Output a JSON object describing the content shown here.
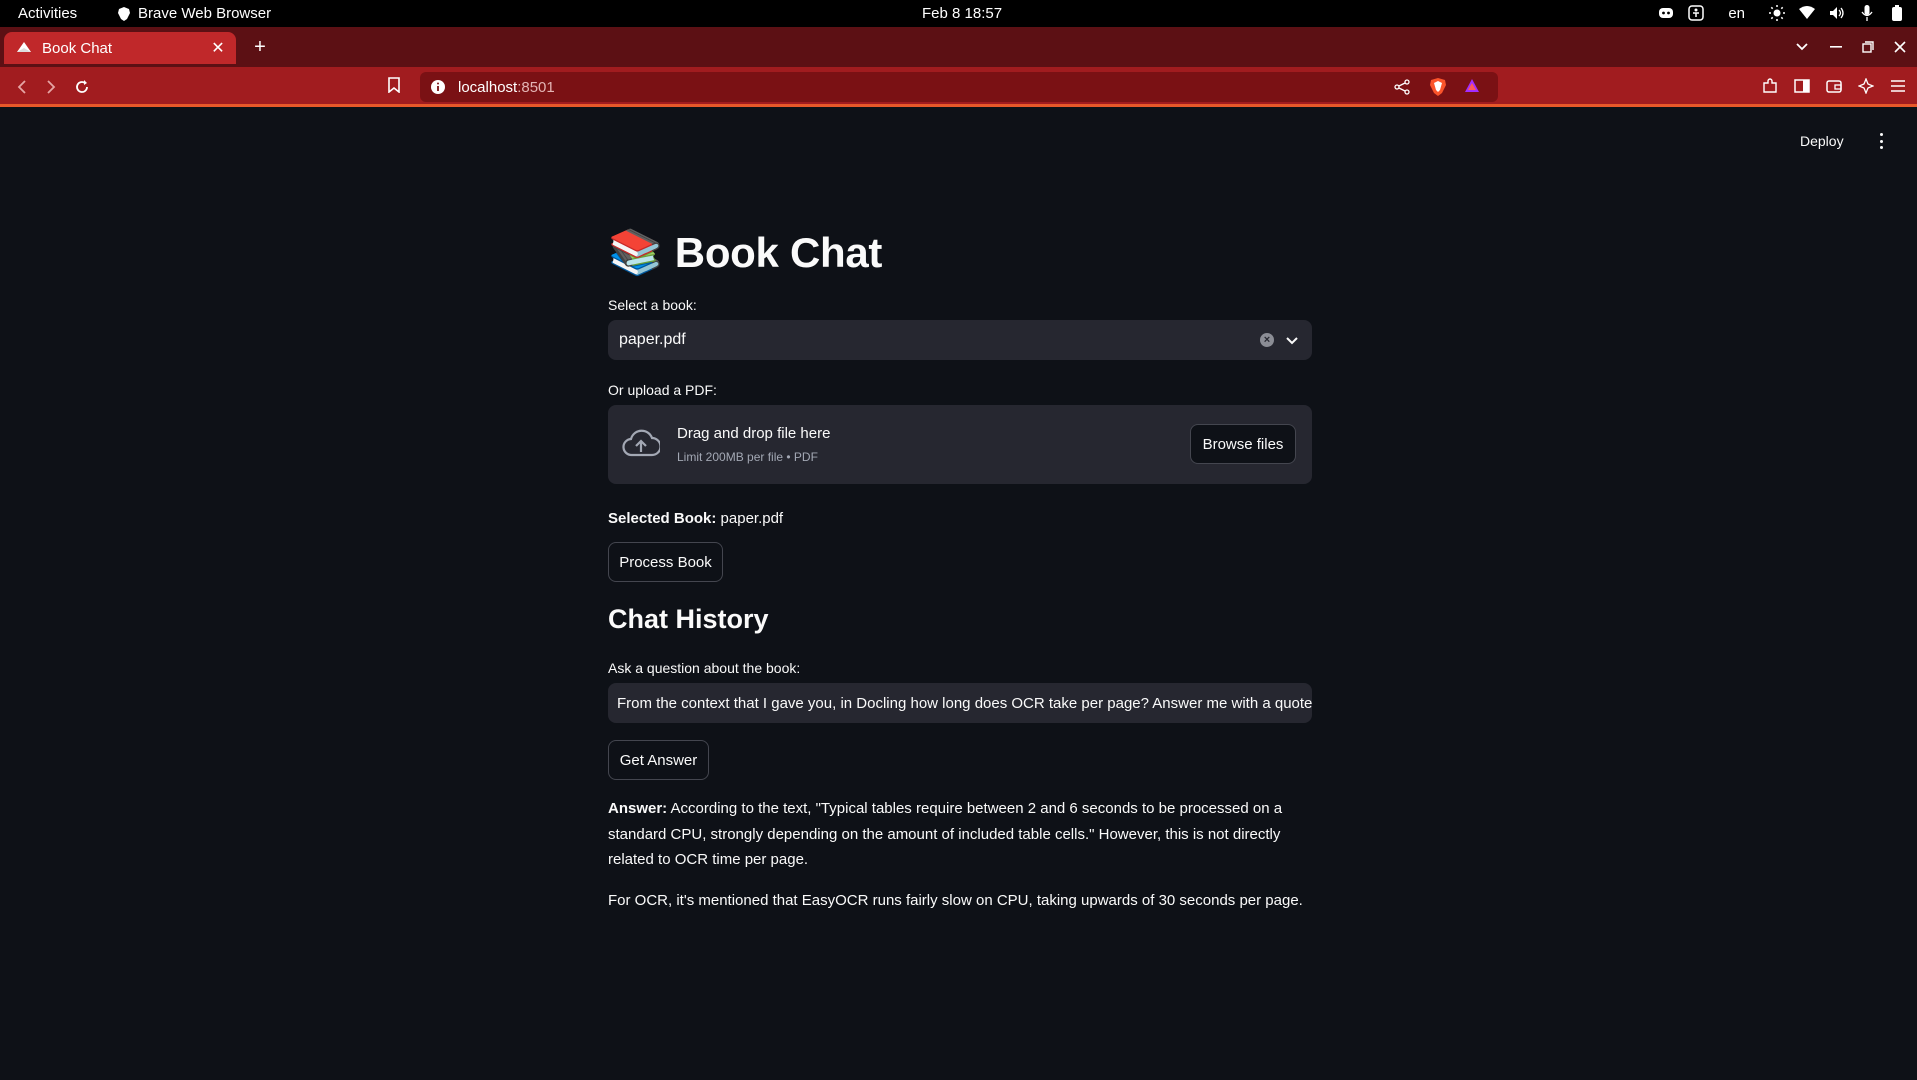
{
  "system": {
    "activities": "Activities",
    "app_name": "Brave Web Browser",
    "clock": "Feb 8  18:57",
    "lang": "en"
  },
  "browser": {
    "tab_title": "Book Chat",
    "url_host": "localhost",
    "url_port": ":8501"
  },
  "header": {
    "deploy_label": "Deploy"
  },
  "page": {
    "title_emoji": "📚",
    "title": "Book Chat",
    "select_label": "Select a book:",
    "select_value": "paper.pdf",
    "upload_label": "Or upload a PDF:",
    "upload_dropzone_text": "Drag and drop file here",
    "upload_limit_text": "Limit 200MB per file • PDF",
    "browse_label": "Browse files",
    "selected_book_label": "Selected Book:",
    "selected_book_value": " paper.pdf",
    "process_label": "Process Book",
    "chat_history_heading": "Chat History",
    "question_label": "Ask a question about the book:",
    "question_value": "From the context that I gave you, in Docling how long does OCR take per page? Answer me with a quote",
    "get_answer_label": "Get Answer",
    "answer_label": "Answer:",
    "answer_text": " According to the text, \"Typical tables require between 2 and 6 seconds to be processed on a standard CPU, strongly depending on the amount of included table cells.\" However, this is not directly related to OCR time per page.",
    "answer_followup": "For OCR, it's mentioned that EasyOCR runs fairly slow on CPU, taking upwards of 30 seconds per page."
  },
  "colors": {
    "background": "#0e1117",
    "widget": "#262730",
    "browser_toolbar": "#a11c1f",
    "tab_active": "#c0282a"
  }
}
